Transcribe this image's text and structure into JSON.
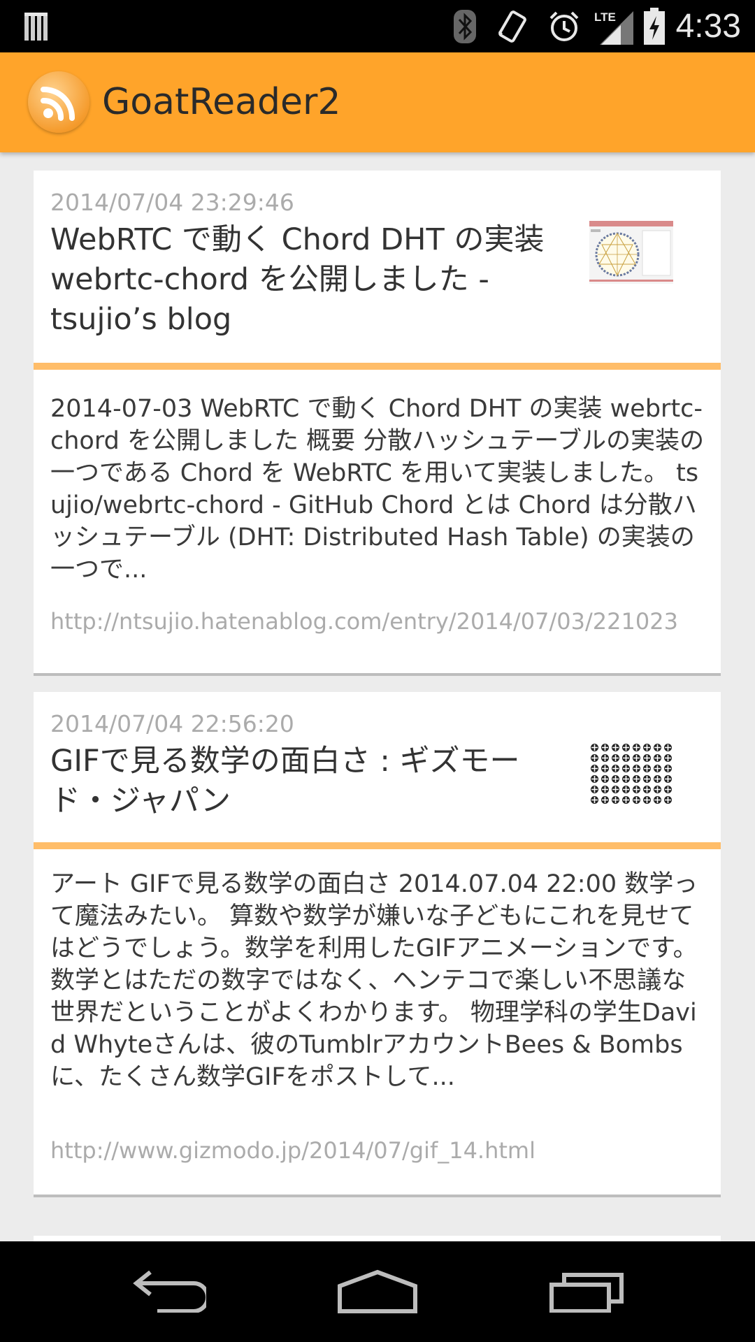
{
  "status_bar": {
    "time": "4:33",
    "network": "LTE",
    "icons": [
      "notification-bars-icon",
      "bluetooth-icon",
      "vibrate-icon",
      "alarm-icon",
      "lte-signal-icon",
      "battery-charging-icon"
    ]
  },
  "app": {
    "title": "GoatReader2",
    "logo_icon": "rss-icon",
    "accent_color": "#ffa42a",
    "divider_color": "#ffbd69"
  },
  "feed": {
    "entries": [
      {
        "date": "2014/07/04 23:29:46",
        "title": "WebRTC で動く Chord DHT の実装 webrtc-chord を公開しました - tsujio’s blog",
        "summary": "2014-07-03 WebRTC で動く Chord DHT の実装 webrtc-chord を公開しました 概要 分散ハッシュテーブルの実装の一つである Chord を WebRTC を用いて実装しました。 tsujio/webrtc-chord - GitHub Chord とは Chord は分散ハッシュテーブル (DHT: Distributed Hash Table) の実装の一つで...",
        "url": "http://ntsujio.hatenablog.com/entry/2014/07/03/221023",
        "thumbnail": "chord-ring-diagram-thumbnail"
      },
      {
        "date": "2014/07/04 22:56:20",
        "title": "GIFで見る数学の面白さ : ギズモード・ジャパン",
        "summary": "アート GIFで見る数学の面白さ 2014.07.04 22:00 数学って魔法みたい。 算数や数学が嫌いな子どもにこれを見せてはどうでしょう。数学を利用したGIFアニメーションです。数学とはただの数字ではなく、ヘンテコで楽しい不思議な世界だということがよくわかります。 物理学科の学生David Whyteさんは、彼のTumblrアカウントBees & Bombsに、たくさん数学GIFをポストして...",
        "url": "http://www.gizmodo.jp/2014/07/gif_14.html",
        "thumbnail": "math-pattern-gif-thumbnail"
      }
    ]
  },
  "nav_bar": {
    "back": "back-icon",
    "home": "home-icon",
    "recents": "recent-apps-icon"
  }
}
